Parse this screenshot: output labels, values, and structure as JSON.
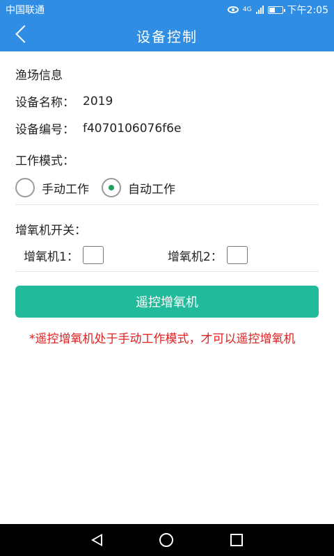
{
  "status_bar": {
    "carrier": "中国联通",
    "network": "4G",
    "time": "下午2:05"
  },
  "header": {
    "title": "设备控制"
  },
  "farm_info": {
    "section_title": "渔场信息",
    "device_name_label": "设备名称：",
    "device_name_value": "2019",
    "device_id_label": "设备编号：",
    "device_id_value": "f4070106076f6e"
  },
  "work_mode": {
    "label": "工作模式：",
    "options": [
      {
        "label": "手动工作",
        "selected": false
      },
      {
        "label": "自动工作",
        "selected": true
      }
    ]
  },
  "aerators": {
    "label": "增氧机开关：",
    "items": [
      {
        "label": "增氧机1：",
        "checked": false
      },
      {
        "label": "增氧机2：",
        "checked": false
      }
    ]
  },
  "remote_button": {
    "label": "遥控增氧机"
  },
  "note": {
    "text": "*遥控增氧机处于手动工作模式，才可以遥控增氧机"
  },
  "colors": {
    "primary": "#2f8de4",
    "button": "#21ba9a",
    "warning": "#e02020",
    "radio_selected": "#1ea35a"
  }
}
